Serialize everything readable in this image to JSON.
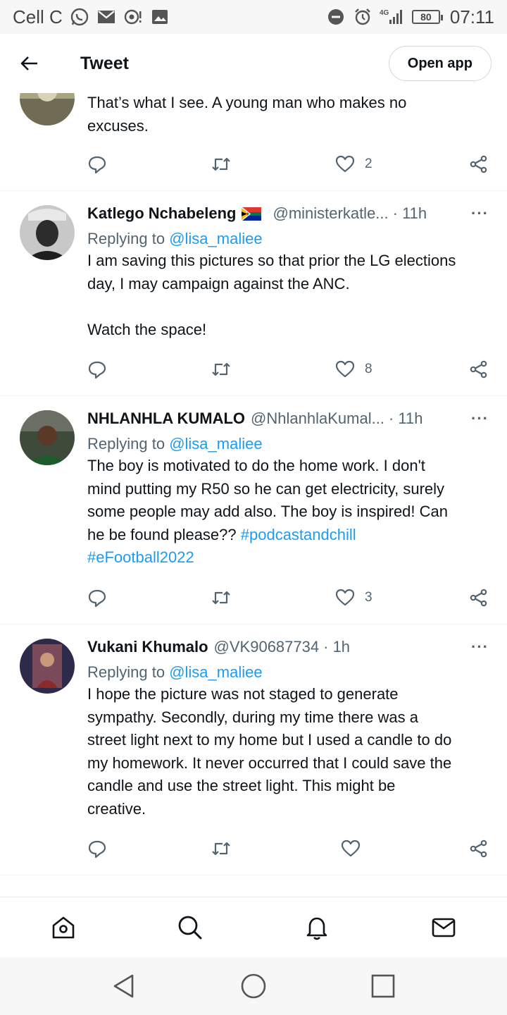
{
  "status_bar": {
    "carrier": "Cell C",
    "battery": "80",
    "time": "07:11",
    "network": "4G"
  },
  "header": {
    "title": "Tweet",
    "open_app_label": "Open app"
  },
  "tweets": [
    {
      "name": "",
      "text": "That’s what I see. A young man who makes no\nexcuses.",
      "likes": "2"
    },
    {
      "name": "Katlego Nchabeleng",
      "handle": "@ministerkatle...",
      "time": "· 11h",
      "reply_prefix": "Replying to",
      "reply_to": "@lisa_maliee",
      "text": "I am saving this pictures so that prior the LG elections\nday, I may campaign against the ANC.\n\nWatch the space!",
      "likes": "8"
    },
    {
      "name": "NHLANHLA KUMALO",
      "handle": "@NhlanhlaKumal...",
      "time": "· 11h",
      "reply_prefix": "Replying to",
      "reply_to": "@lisa_maliee",
      "text": "The boy is motivated to do the home work. I don't\nmind putting my R50 so he can get electricity, surely\nsome people may add also. The boy is inspired!  Can\nhe be found please?? ",
      "hashtag1": "#podcastandchill",
      "hashtag2": "#eFootball2022",
      "likes": "3"
    },
    {
      "name": "Vukani Khumalo",
      "handle": "@VK90687734",
      "time": "· 1h",
      "reply_prefix": "Replying to",
      "reply_to": "@lisa_maliee",
      "text": "I hope the picture was not staged to generate\nsympathy. Secondly, during my time there was a\nstreet light next to my home but I used a candle to do\nmy homework. It never occurred that I could save the\ncandle and use the street light. This might be\ncreative.",
      "likes": ""
    }
  ],
  "more_label": "···",
  "colors": {
    "link": "#1d9bf0",
    "secondary": "#536471",
    "text": "#0f1419"
  },
  "icons": [
    "arrow-left-icon",
    "reply-icon",
    "retweet-icon",
    "heart-icon",
    "share-icon",
    "home-icon",
    "search-icon",
    "bell-icon",
    "mail-icon",
    "back-triangle-icon",
    "home-circle-icon",
    "recents-square-icon"
  ]
}
